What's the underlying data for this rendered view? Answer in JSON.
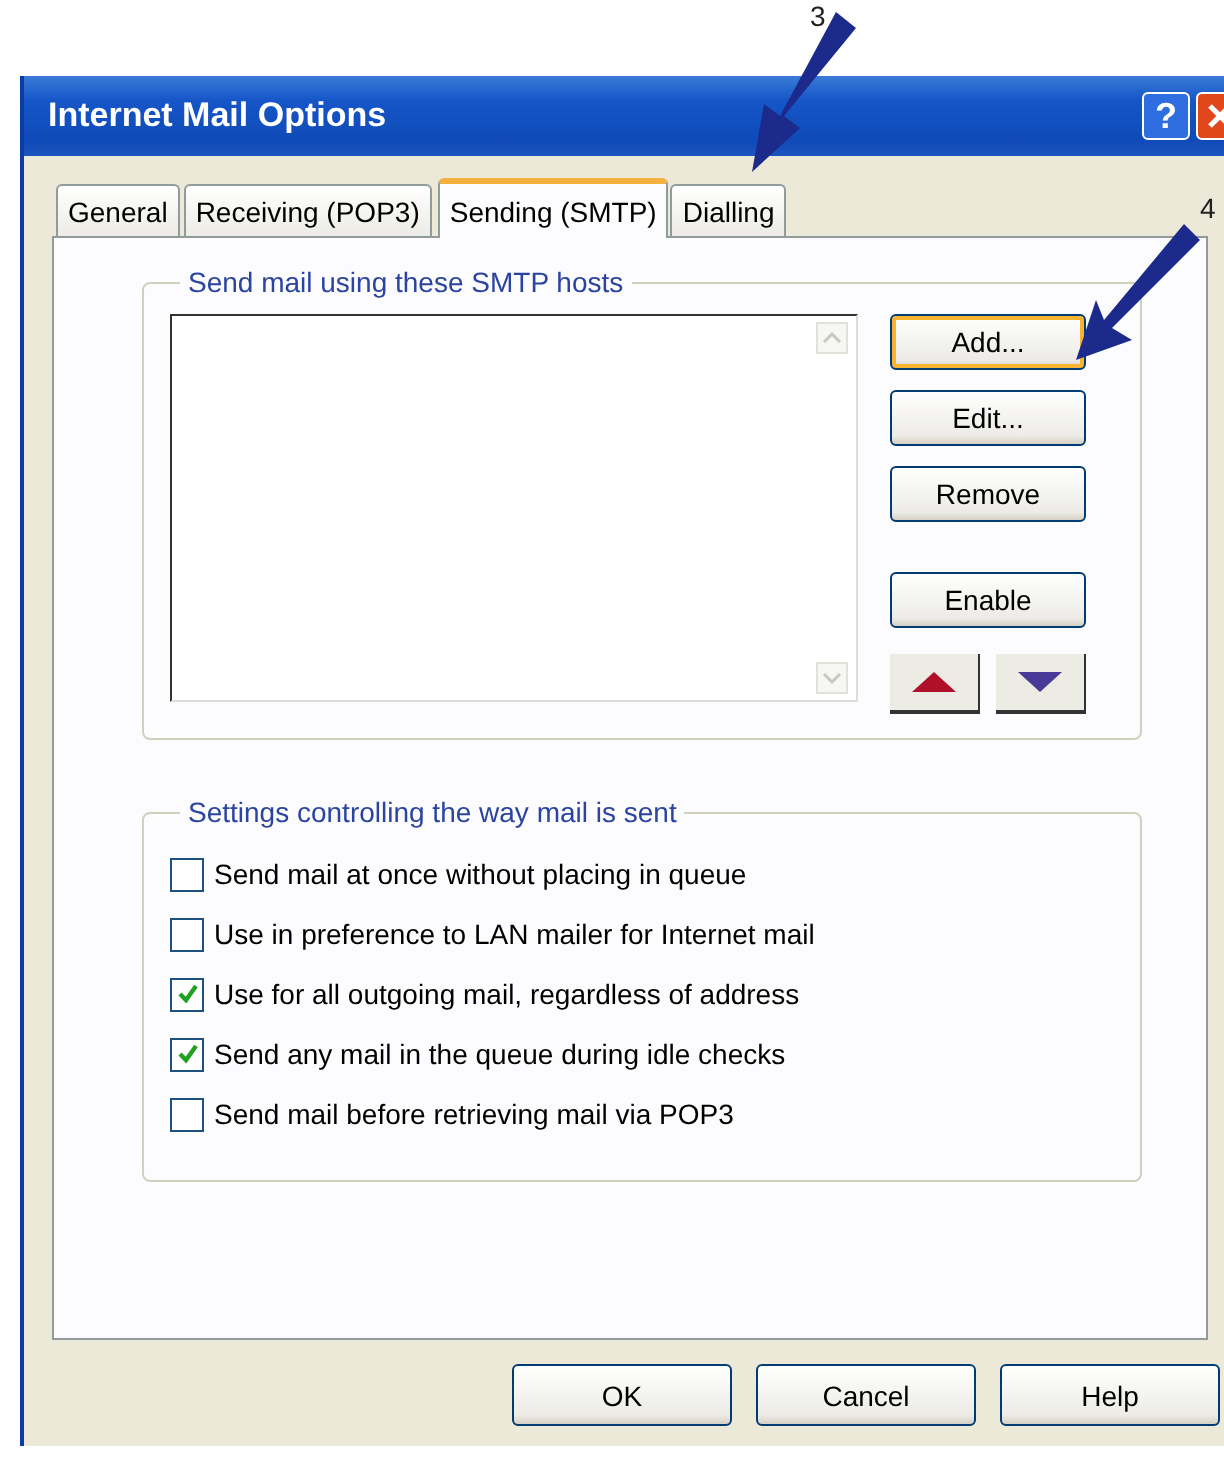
{
  "window": {
    "title": "Internet Mail Options",
    "help_button": "?"
  },
  "tabs": [
    {
      "label": "General",
      "selected": false
    },
    {
      "label": "Receiving (POP3)",
      "selected": false
    },
    {
      "label": "Sending (SMTP)",
      "selected": true
    },
    {
      "label": "Dialling",
      "selected": false
    }
  ],
  "hosts_group": {
    "title": "Send mail using these SMTP hosts",
    "buttons": [
      {
        "label": "Add...",
        "focused": true
      },
      {
        "label": "Edit...",
        "focused": false
      },
      {
        "label": "Remove",
        "focused": false
      },
      {
        "label": "Enable",
        "focused": false
      }
    ]
  },
  "options_group": {
    "title": "Settings controlling the way mail is sent",
    "options": [
      {
        "label": "Send mail at once without placing in queue",
        "checked": false
      },
      {
        "label": "Use in preference to LAN mailer for Internet mail",
        "checked": false
      },
      {
        "label": "Use for all outgoing mail, regardless of address",
        "checked": true
      },
      {
        "label": "Send any mail in the queue during idle checks",
        "checked": true
      },
      {
        "label": "Send mail before retrieving mail via POP3",
        "checked": false
      }
    ]
  },
  "buttons": [
    "OK",
    "Cancel",
    "Help"
  ],
  "annotations": [
    {
      "label": "3"
    },
    {
      "label": "4"
    }
  ]
}
